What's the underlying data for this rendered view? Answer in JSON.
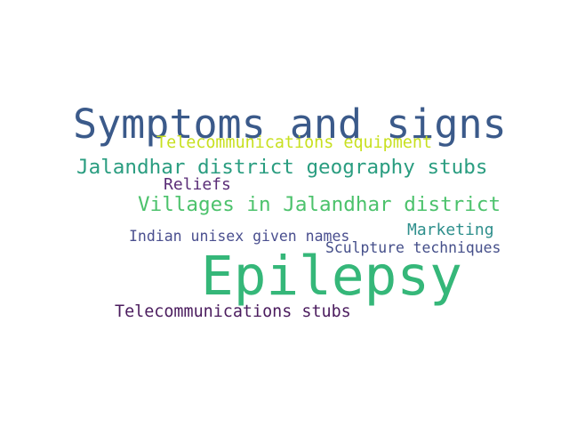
{
  "words": [
    {
      "text": "Symptoms and signs",
      "color": "#3b5a8a"
    },
    {
      "text": "Telecommunications equipment",
      "color": "#c8e020"
    },
    {
      "text": "Jalandhar district geography stubs",
      "color": "#2a9d80"
    },
    {
      "text": "Reliefs",
      "color": "#5a2d77"
    },
    {
      "text": "Villages in Jalandhar district",
      "color": "#4cc26c"
    },
    {
      "text": "Indian unisex given names",
      "color": "#4a4f8f"
    },
    {
      "text": "Marketing",
      "color": "#2e8f8c"
    },
    {
      "text": "Sculpture techniques",
      "color": "#454f8a"
    },
    {
      "text": "Epilepsy",
      "color": "#35b779"
    },
    {
      "text": "Telecommunications stubs",
      "color": "#4b1c5e"
    }
  ]
}
